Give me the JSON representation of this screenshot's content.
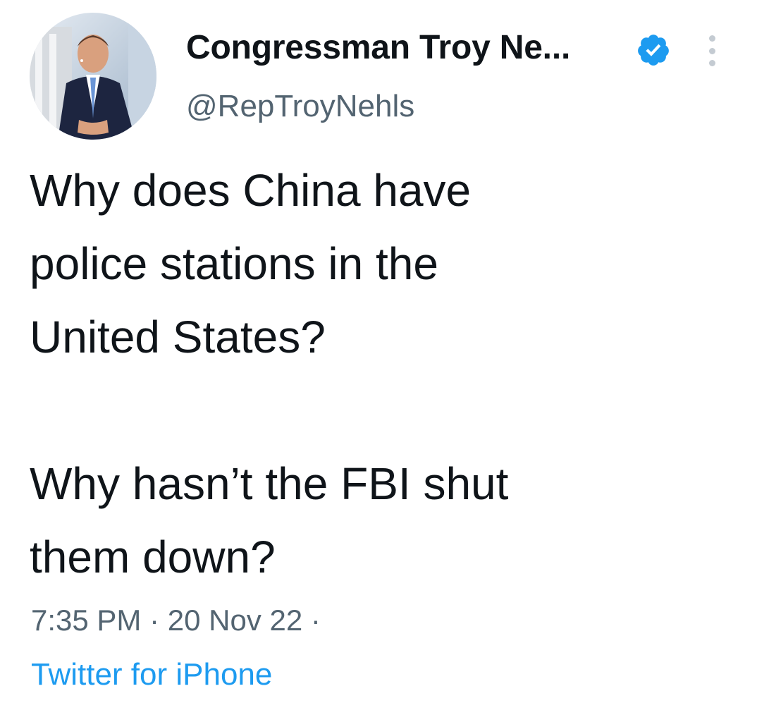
{
  "tweet": {
    "author": {
      "display_name": "Congressman Troy Ne...",
      "handle": "@RepTroyNehls",
      "verified_icon": "verified-badge-icon"
    },
    "text": "Why does China have\npolice stations in the\nUnited States?\n\nWhy hasn’t the FBI shut\nthem down?",
    "timestamp": "7:35 PM · 20 Nov 22 ·",
    "source": "Twitter for iPhone"
  },
  "colors": {
    "text_primary": "#0f1419",
    "text_secondary": "#536471",
    "link": "#1d9bf0",
    "verified": "#1d9bf0"
  }
}
